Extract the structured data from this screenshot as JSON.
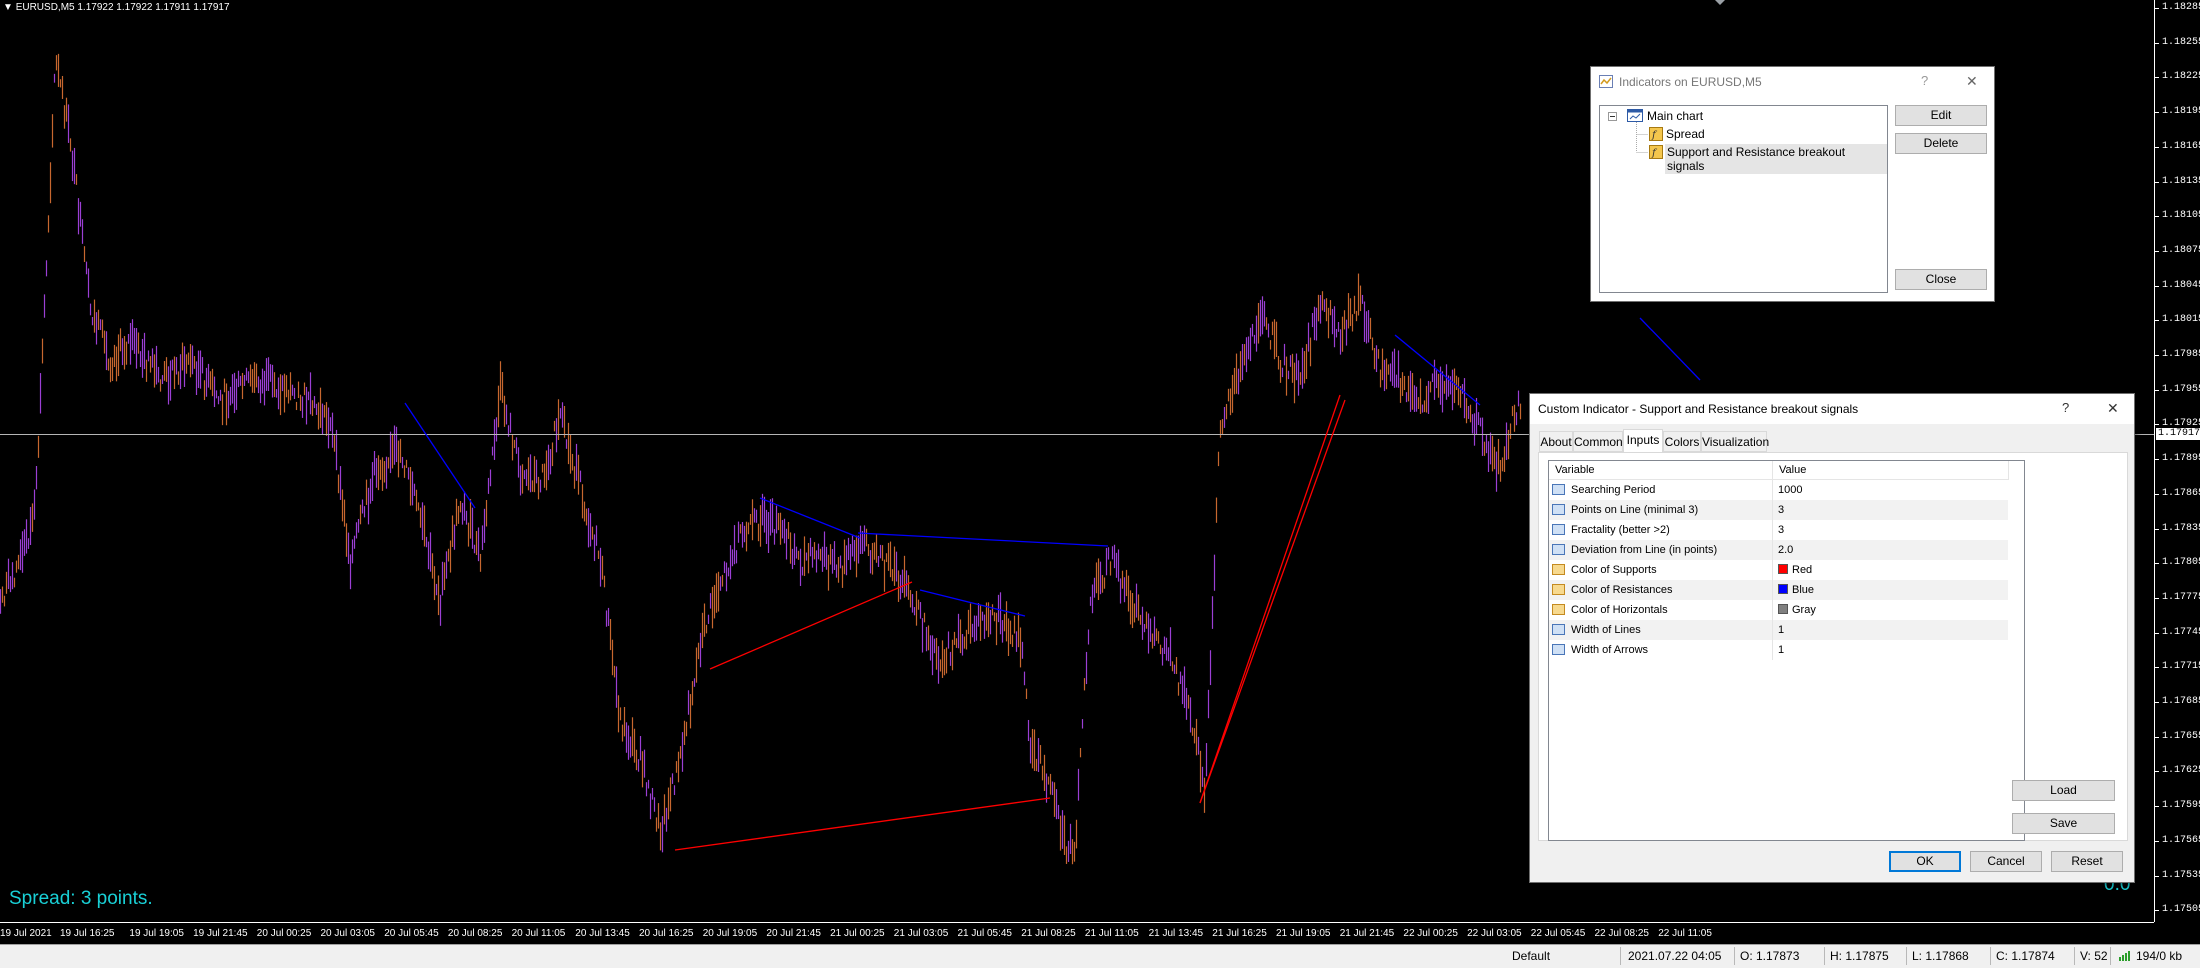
{
  "chart": {
    "symbol_header": "EURUSD,M5  1.17922 1.17922 1.17911 1.17917",
    "current_price": "1.17917",
    "spread_text": "Spread: 3 points.",
    "small_value": "0.0",
    "price_labels": [
      "1.18285",
      "1.18255",
      "1.18225",
      "1.18195",
      "1.18165",
      "1.18135",
      "1.18105",
      "1.18075",
      "1.18045",
      "1.18015",
      "1.17985",
      "1.17955",
      "1.17925",
      "1.17895",
      "1.17865",
      "1.17835",
      "1.17805",
      "1.17775",
      "1.17745",
      "1.17715",
      "1.17685",
      "1.17655",
      "1.17625",
      "1.17595",
      "1.17565",
      "1.17535",
      "1.17505"
    ],
    "time_labels": [
      "19 Jul 2021",
      "19 Jul 16:25",
      "19 Jul 19:05",
      "19 Jul 21:45",
      "20 Jul 00:25",
      "20 Jul 03:05",
      "20 Jul 05:45",
      "20 Jul 08:25",
      "20 Jul 11:05",
      "20 Jul 13:45",
      "20 Jul 16:25",
      "20 Jul 19:05",
      "20 Jul 21:45",
      "21 Jul 00:25",
      "21 Jul 03:05",
      "21 Jul 05:45",
      "21 Jul 08:25",
      "21 Jul 11:05",
      "21 Jul 13:45",
      "21 Jul 16:25",
      "21 Jul 19:05",
      "21 Jul 21:45",
      "22 Jul 00:25",
      "22 Jul 03:05",
      "22 Jul 05:45",
      "22 Jul 08:25",
      "22 Jul 11:05"
    ],
    "colors": {
      "candle": "#9b3fd4",
      "candle_alt": "#c7672f",
      "support": "#ff0000",
      "resistance": "#0000ff",
      "horizontal": "#808080",
      "grid_text": "#ffffff",
      "cyan": "#19d0d6"
    }
  },
  "status_bar": {
    "profile": "Default",
    "datetime": "2021.07.22 04:05",
    "open": "O: 1.17873",
    "high": "H: 1.17875",
    "low": "L: 1.17868",
    "close": "C: 1.17874",
    "volume": "V: 52",
    "traffic": "194/0 kb"
  },
  "indicators_dialog": {
    "title": "Indicators on EURUSD,M5",
    "help_glyph": "?",
    "close_glyph": "✕",
    "tree": {
      "root": "Main chart",
      "children": [
        "Spread",
        "Support and Resistance breakout signals"
      ]
    },
    "edit_label": "Edit",
    "delete_label": "Delete",
    "close_label": "Close"
  },
  "custom_dialog": {
    "title": "Custom Indicator - Support and Resistance breakout signals",
    "help_glyph": "?",
    "close_glyph": "✕",
    "tabs": [
      "About",
      "Common",
      "Inputs",
      "Colors",
      "Visualization"
    ],
    "active_tab": "Inputs",
    "columns": [
      "Variable",
      "Value"
    ],
    "rows": [
      {
        "variable": "Searching Period",
        "value": "1000",
        "icon": "123"
      },
      {
        "variable": "Points on Line (minimal 3)",
        "value": "3",
        "icon": "123"
      },
      {
        "variable": "Fractality (better >2)",
        "value": "3",
        "icon": "123"
      },
      {
        "variable": "Deviation from Line (in points)",
        "value": "2.0",
        "icon": "1/2"
      },
      {
        "variable": "Color of Supports",
        "value": "Red",
        "icon": "color",
        "swatch": "#ff0000"
      },
      {
        "variable": "Color of Resistances",
        "value": "Blue",
        "icon": "color",
        "swatch": "#0000ff"
      },
      {
        "variable": "Color of Horizontals",
        "value": "Gray",
        "icon": "color",
        "swatch": "#808080"
      },
      {
        "variable": "Width of Lines",
        "value": "1",
        "icon": "123"
      },
      {
        "variable": "Width of Arrows",
        "value": "1",
        "icon": "123"
      }
    ],
    "load_label": "Load",
    "save_label": "Save",
    "ok_label": "OK",
    "cancel_label": "Cancel",
    "reset_label": "Reset"
  }
}
